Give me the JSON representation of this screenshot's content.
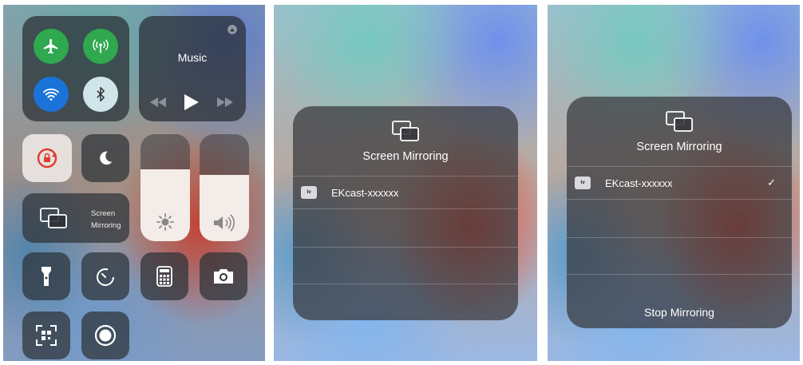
{
  "control_center": {
    "music_label": "Music",
    "screen_mirroring_label_1": "Screen",
    "screen_mirroring_label_2": "Mirroring",
    "colors": {
      "airplane": "#2fa84f",
      "cellular": "#2fa84f",
      "wifi": "#1a73d9",
      "bluetooth": "#cfe5ea",
      "orientation_lock_icon": "#e03a2f"
    },
    "icons": [
      "airplane-icon",
      "cellular-icon",
      "wifi-icon",
      "bluetooth-icon",
      "airplay-icon",
      "rewind-icon",
      "play-icon",
      "fast-forward-icon",
      "orientation-lock-icon",
      "moon-icon",
      "screen-mirroring-icon",
      "brightness-icon",
      "volume-icon",
      "flashlight-icon",
      "timer-icon",
      "calculator-icon",
      "camera-icon",
      "qr-scanner-icon",
      "screen-record-icon"
    ],
    "brightness_level": 0.67,
    "volume_level": 0.62
  },
  "mirroring_list": {
    "title": "Screen Mirroring",
    "device_badge": "tv",
    "device_name": "EKcast-xxxxxx"
  },
  "mirroring_connected": {
    "title": "Screen Mirroring",
    "device_badge": "tv",
    "device_name": "EKcast-xxxxxx",
    "checkmark": "✓",
    "stop_label": "Stop Mirroring"
  }
}
